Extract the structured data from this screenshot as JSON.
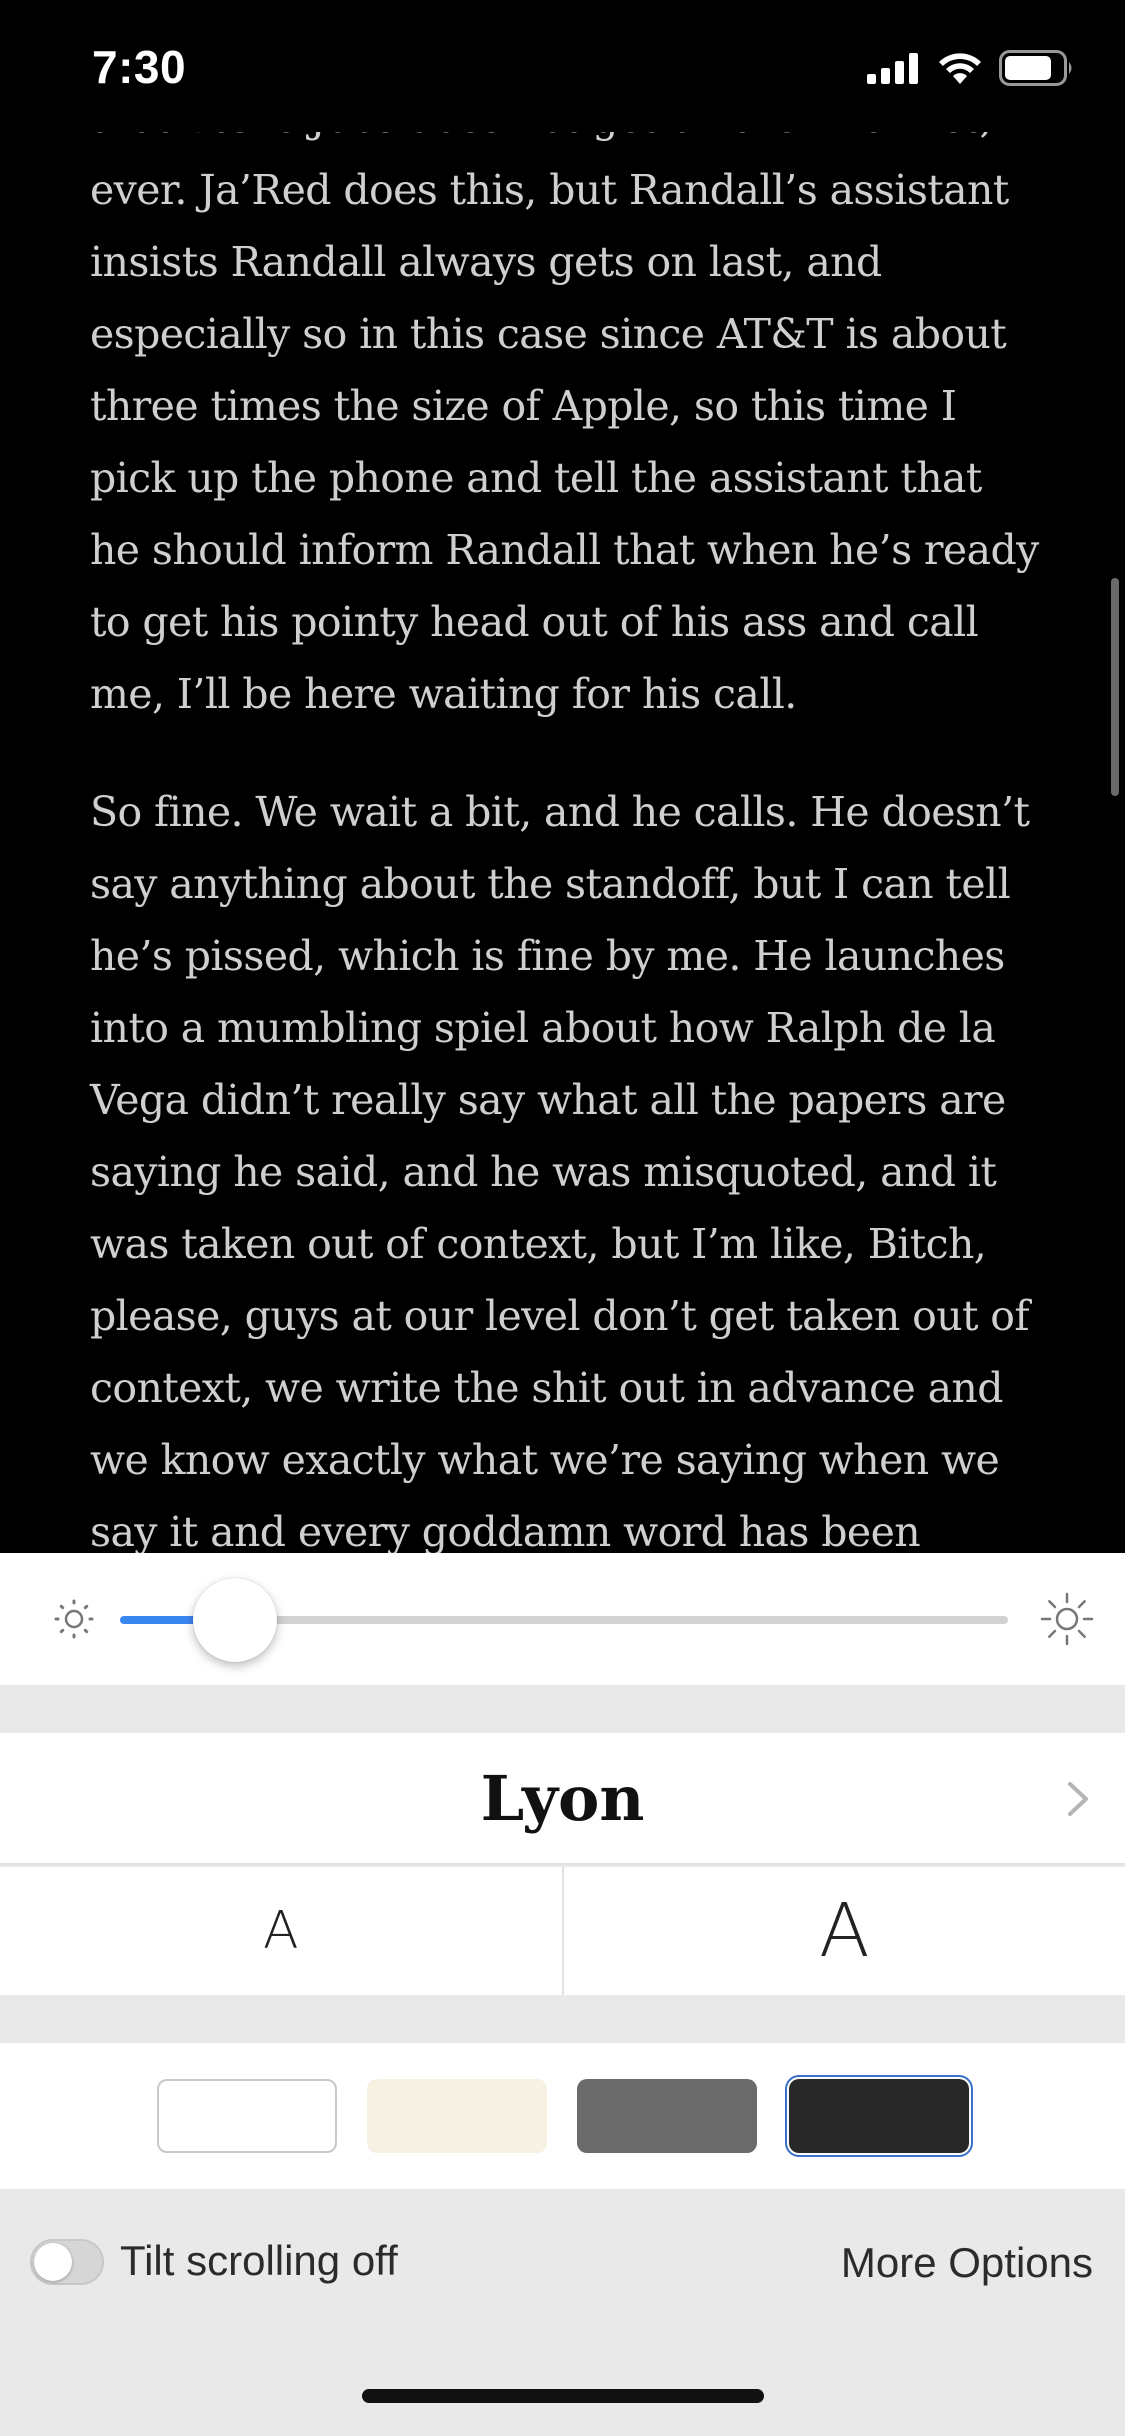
{
  "status_bar": {
    "time": "7:30",
    "icons": [
      "cellular-signal-icon",
      "wifi-icon",
      "battery-icon"
    ]
  },
  "reader": {
    "paragraphs": [
      "that Steve Jobs does not get on the line first, ever. Ja’Red does this, but Randall’s assistant insists Randall always gets on last, and especially so in this case since AT&T is about three times the size of Apple, so this time I pick up the phone and tell the assistant that he should inform Randall that when he’s ready to get his pointy head out of his ass and call me, I’ll be here waiting for his call.",
      "So fine. We wait a bit, and he calls. He doesn’t say anything about the standoff, but I can tell he’s pissed, which is fine by me. He launches into a mumbling spiel about how Ralph de la Vega didn’t really say what all the papers are saying he said, and he was misquoted, and it was taken out of context, but I’m like, Bitch, please, guys at our level don’t get taken out of context, we write the shit out in advance and we know exactly what we’re saying when we say it and every goddamn word has been"
    ],
    "text_color": "#cfcfcf",
    "background": "#000000"
  },
  "settings": {
    "brightness": {
      "level": 0.13,
      "low_icon": "brightness-low-icon",
      "high_icon": "brightness-high-icon",
      "accent": "#3a86f0"
    },
    "font": {
      "name": "Lyon",
      "chevron_icon": "chevron-right-icon"
    },
    "size": {
      "decrease_label": "A",
      "increase_label": "A"
    },
    "themes": [
      {
        "name": "white",
        "color": "#ffffff",
        "selected": false
      },
      {
        "name": "sepia",
        "color": "#f7f1e4",
        "selected": false
      },
      {
        "name": "gray",
        "color": "#6b6b6b",
        "selected": false
      },
      {
        "name": "night",
        "color": "#282828",
        "selected": true
      }
    ],
    "tilt_scrolling": {
      "label": "Tilt scrolling off",
      "enabled": false
    },
    "more_options_label": "More Options"
  }
}
